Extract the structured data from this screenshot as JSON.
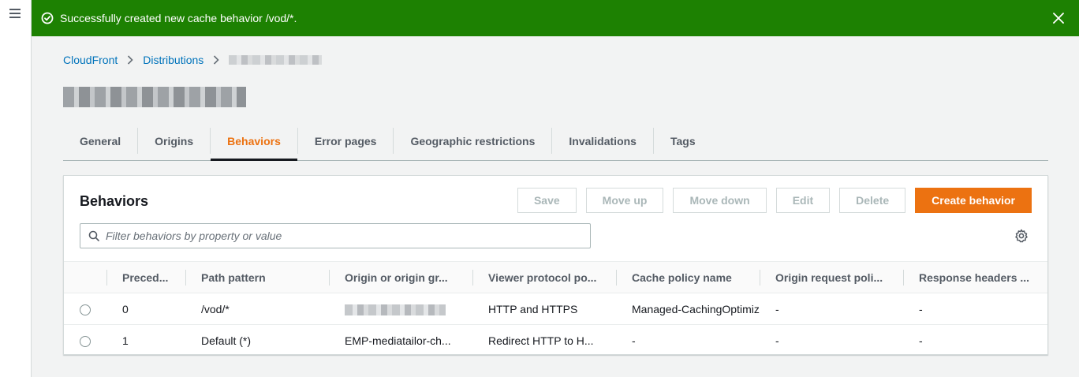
{
  "flash": {
    "message": "Successfully created new cache behavior /vod/*.",
    "color": "#1d8102"
  },
  "breadcrumb": {
    "items": [
      "CloudFront",
      "Distributions"
    ]
  },
  "tabs": [
    {
      "label": "General"
    },
    {
      "label": "Origins"
    },
    {
      "label": "Behaviors",
      "active": true
    },
    {
      "label": "Error pages"
    },
    {
      "label": "Geographic restrictions"
    },
    {
      "label": "Invalidations"
    },
    {
      "label": "Tags"
    }
  ],
  "behaviors": {
    "title": "Behaviors",
    "buttons": {
      "save": "Save",
      "move_up": "Move up",
      "move_down": "Move down",
      "edit": "Edit",
      "delete": "Delete",
      "create": "Create behavior"
    },
    "filter_placeholder": "Filter behaviors by property or value",
    "columns": [
      "Preced...",
      "Path pattern",
      "Origin or origin gr...",
      "Viewer protocol po...",
      "Cache policy name",
      "Origin request poli...",
      "Response headers ..."
    ],
    "rows": [
      {
        "precedence": "0",
        "path": "/vod/*",
        "origin": "",
        "viewer": "HTTP and HTTPS",
        "cache": "Managed-CachingOptimiz",
        "origin_request": "-",
        "response_headers": "-"
      },
      {
        "precedence": "1",
        "path": "Default (*)",
        "origin": "EMP-mediatailor-ch...",
        "viewer": "Redirect HTTP to H...",
        "cache": "-",
        "origin_request": "-",
        "response_headers": "-"
      }
    ]
  },
  "colors": {
    "accent": "#ec7211",
    "link": "#0073bb"
  }
}
